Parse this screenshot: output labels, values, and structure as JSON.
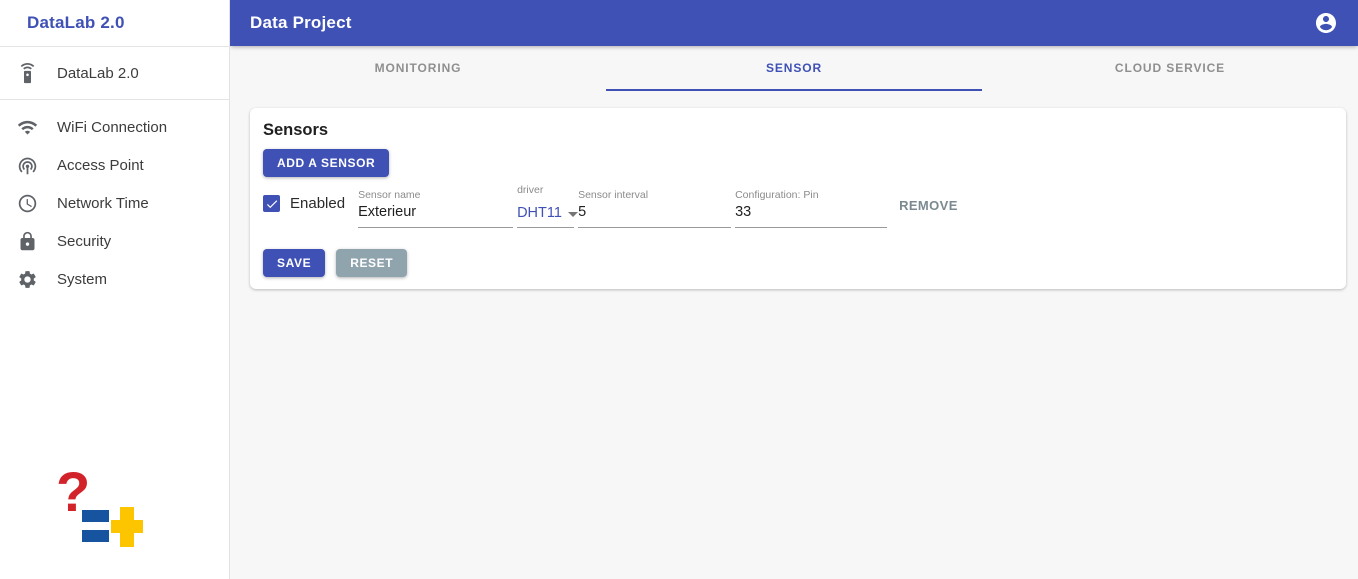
{
  "sidebar": {
    "title": "DataLab 2.0",
    "items": [
      {
        "label": "DataLab 2.0",
        "icon": "remote-device-icon"
      },
      {
        "label": "WiFi Connection",
        "icon": "wifi-icon"
      },
      {
        "label": "Access Point",
        "icon": "wifi-tethering-icon"
      },
      {
        "label": "Network Time",
        "icon": "clock-icon"
      },
      {
        "label": "Security",
        "icon": "lock-icon"
      },
      {
        "label": "System",
        "icon": "gear-icon"
      }
    ],
    "logo": {
      "question_mark": "?"
    }
  },
  "appbar": {
    "title": "Data Project",
    "account_icon": "account-circle-icon"
  },
  "tabs": [
    {
      "label": "MONITORING",
      "active": false
    },
    {
      "label": "SENSOR",
      "active": true
    },
    {
      "label": "CLOUD SERVICE",
      "active": false
    }
  ],
  "sensors": {
    "heading": "Sensors",
    "add_button": "ADD A SENSOR",
    "row": {
      "enabled_label": "Enabled",
      "enabled_checked": true,
      "fields": [
        {
          "label": "Sensor name",
          "value": "Exterieur",
          "type": "text"
        },
        {
          "label": "driver",
          "value": "DHT11",
          "type": "select"
        },
        {
          "label": "Sensor interval",
          "value": "5",
          "type": "text"
        },
        {
          "label": "Configuration: Pin",
          "value": "33",
          "type": "text"
        }
      ],
      "remove_button": "REMOVE"
    },
    "save_button": "SAVE",
    "reset_button": "RESET"
  },
  "colors": {
    "primary": "#3f51b5",
    "reset_button": "#90a4ae",
    "logo_red": "#d2222a",
    "logo_blue": "#17549f",
    "logo_yellow": "#fdc500"
  }
}
